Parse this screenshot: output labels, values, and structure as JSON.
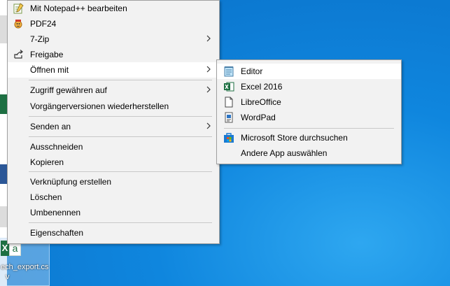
{
  "desktop": {
    "file_name_line1": "ech_export.cs",
    "file_name_line2": "v",
    "file_icon_letter": "X",
    "file_page_letter": "a"
  },
  "context_menu": {
    "items": [
      {
        "label": "Mit Notepad++ bearbeiten",
        "icon": "notepadpp-icon"
      },
      {
        "label": "PDF24",
        "icon": "pdf24-icon"
      },
      {
        "label": "7-Zip",
        "has_submenu": true
      },
      {
        "label": "Freigabe",
        "icon": "share-icon"
      },
      {
        "label": "Öffnen mit",
        "has_submenu": true,
        "highlighted": true
      },
      {
        "label": "Zugriff gewähren auf",
        "has_submenu": true
      },
      {
        "label": "Vorgängerversionen wiederherstellen"
      },
      {
        "label": "Senden an",
        "has_submenu": true
      },
      {
        "label": "Ausschneiden"
      },
      {
        "label": "Kopieren"
      },
      {
        "label": "Verknüpfung erstellen"
      },
      {
        "label": "Löschen"
      },
      {
        "label": "Umbenennen"
      },
      {
        "label": "Eigenschaften"
      }
    ]
  },
  "open_with_menu": {
    "items": [
      {
        "label": "Editor",
        "icon": "notepad-icon",
        "highlighted": true
      },
      {
        "label": "Excel 2016",
        "icon": "excel-icon"
      },
      {
        "label": "LibreOffice",
        "icon": "libreoffice-icon"
      },
      {
        "label": "WordPad",
        "icon": "wordpad-icon"
      },
      {
        "label": "Microsoft Store durchsuchen",
        "icon": "store-icon"
      },
      {
        "label": "Andere App auswählen"
      }
    ]
  },
  "colors": {
    "desktop_blue": "#0f86de",
    "menu_bg": "#f2f2f2",
    "highlight": "#ffffff",
    "excel_green": "#1d6f42"
  }
}
